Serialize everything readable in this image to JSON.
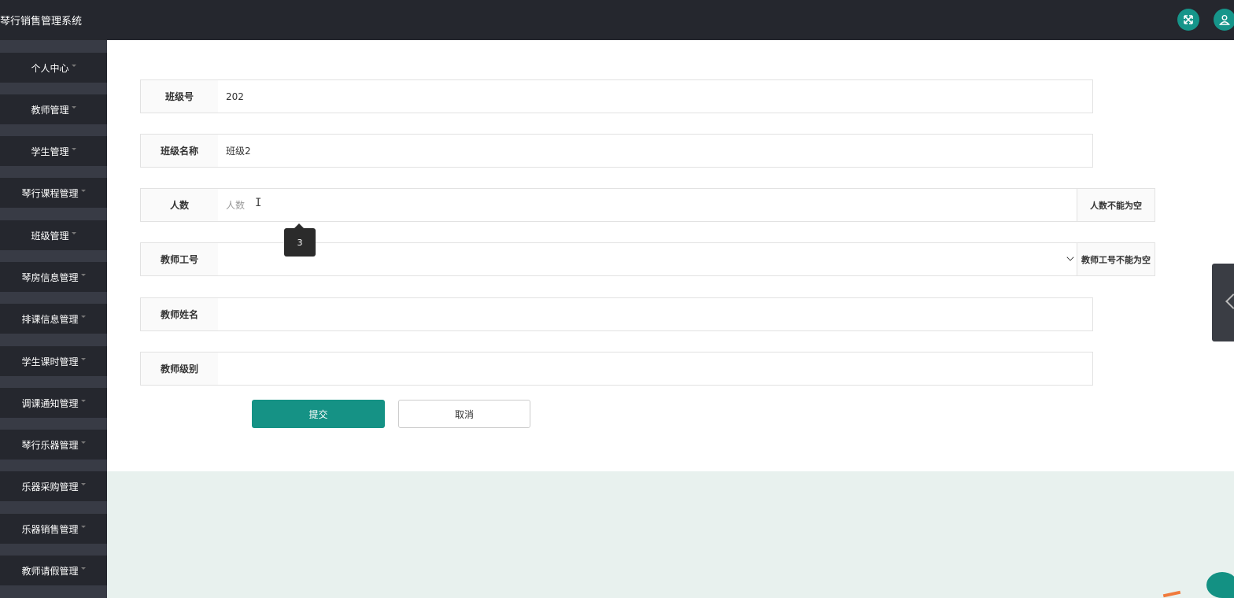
{
  "app": {
    "title": "琴行销售管理系统"
  },
  "header": {
    "icons": [
      "fullscreen-icon",
      "user-icon"
    ]
  },
  "sidebar": {
    "items": [
      {
        "label": "个人中心"
      },
      {
        "label": "教师管理"
      },
      {
        "label": "学生管理"
      },
      {
        "label": "琴行课程管理"
      },
      {
        "label": "班级管理"
      },
      {
        "label": "琴房信息管理"
      },
      {
        "label": "排课信息管理"
      },
      {
        "label": "学生课时管理"
      },
      {
        "label": "调课通知管理"
      },
      {
        "label": "琴行乐器管理"
      },
      {
        "label": "乐器采购管理"
      },
      {
        "label": "乐器销售管理"
      },
      {
        "label": "教师请假管理"
      }
    ]
  },
  "form": {
    "class_no": {
      "label": "班级号",
      "value": "202"
    },
    "class_name": {
      "label": "班级名称",
      "value": "班级2"
    },
    "count": {
      "label": "人数",
      "value": "",
      "placeholder": "人数",
      "error": "人数不能为空",
      "tooltip": "3"
    },
    "teacher_no": {
      "label": "教师工号",
      "value": "",
      "error": "教师工号不能为空"
    },
    "teacher_name": {
      "label": "教师姓名",
      "value": ""
    },
    "teacher_level": {
      "label": "教师级别",
      "value": ""
    },
    "submit_label": "提交",
    "cancel_label": "取消"
  },
  "colors": {
    "primary": "#159285",
    "topbar": "#25272e",
    "sidebar_item": "#25272e",
    "background": "#e8f1ee"
  }
}
